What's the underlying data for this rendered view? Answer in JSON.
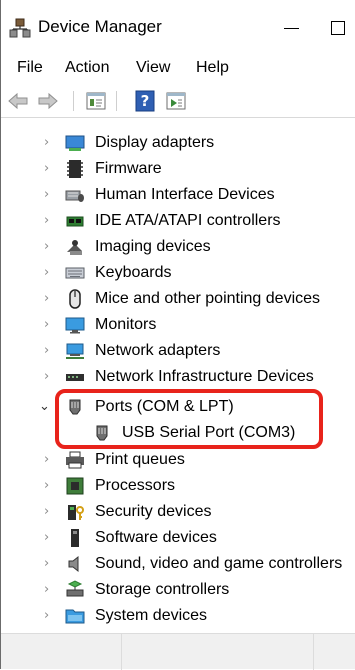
{
  "window": {
    "title": "Device Manager",
    "title_icon": "device-manager-icon"
  },
  "menu": {
    "file": "File",
    "action": "Action",
    "view": "View",
    "help": "Help"
  },
  "toolbar": {
    "buttons": [
      "back-arrow-icon",
      "forward-arrow-icon",
      "properties-icon",
      "help-icon",
      "show-hidden-icon"
    ]
  },
  "tree": {
    "items": [
      {
        "label": "Display adapters",
        "icon": "display-adapter-icon",
        "expanded": false
      },
      {
        "label": "Firmware",
        "icon": "firmware-chip-icon",
        "expanded": false
      },
      {
        "label": "Human Interface Devices",
        "icon": "hid-icon",
        "expanded": false
      },
      {
        "label": "IDE ATA/ATAPI controllers",
        "icon": "ide-controller-icon",
        "expanded": false
      },
      {
        "label": "Imaging devices",
        "icon": "camera-icon",
        "expanded": false
      },
      {
        "label": "Keyboards",
        "icon": "keyboard-icon",
        "expanded": false
      },
      {
        "label": "Mice and other pointing devices",
        "icon": "mouse-icon",
        "expanded": false
      },
      {
        "label": "Monitors",
        "icon": "monitor-icon",
        "expanded": false
      },
      {
        "label": "Network adapters",
        "icon": "network-adapter-icon",
        "expanded": false
      },
      {
        "label": "Network Infrastructure Devices",
        "icon": "network-infrastructure-icon",
        "expanded": false
      },
      {
        "label": "Ports (COM & LPT)",
        "icon": "port-icon",
        "expanded": true
      },
      {
        "label": "USB Serial Port (COM3)",
        "icon": "port-icon",
        "child": true
      },
      {
        "label": "Print queues",
        "icon": "printer-icon",
        "expanded": false
      },
      {
        "label": "Processors",
        "icon": "processor-icon",
        "expanded": false
      },
      {
        "label": "Security devices",
        "icon": "security-device-icon",
        "expanded": false
      },
      {
        "label": "Software devices",
        "icon": "software-device-icon",
        "expanded": false
      },
      {
        "label": "Sound, video and game controllers",
        "icon": "speaker-icon",
        "expanded": false
      },
      {
        "label": "Storage controllers",
        "icon": "storage-controller-icon",
        "expanded": false
      },
      {
        "label": "System devices",
        "icon": "system-devices-icon",
        "expanded": false
      }
    ]
  },
  "colors": {
    "highlight": "#e8231b",
    "status_bar": "#f0f0f0"
  }
}
